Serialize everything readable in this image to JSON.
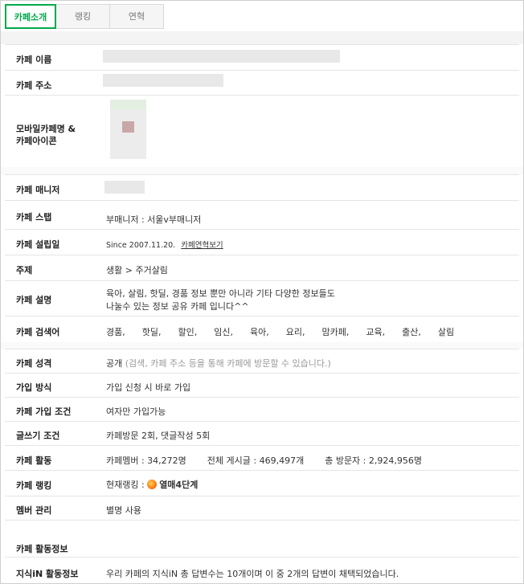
{
  "tabs": [
    {
      "label": "카페소개",
      "active": true
    },
    {
      "label": "랭킹",
      "active": false
    },
    {
      "label": "연혁",
      "active": false
    }
  ],
  "colors": {
    "accent": "#03a94b",
    "border": "#e5e5e5",
    "band": "#f4f4f4"
  },
  "rows": {
    "name": {
      "label": "카페 이름"
    },
    "address": {
      "label": "카페 주소"
    },
    "mobile": {
      "label_line1": "모바일카페명 &",
      "label_line2": "카페아이콘"
    },
    "manager": {
      "label": "카페 매니저"
    },
    "staff": {
      "label": "카페 스탭",
      "value": "부매니저 : 서울v부매니저"
    },
    "founded": {
      "label": "카페 설립일",
      "value": "Since 2007.11.20.",
      "link": "카페연혁보기"
    },
    "topic": {
      "label": "주제",
      "value": "생활 > 주거살림"
    },
    "description": {
      "label": "카페 설명",
      "line1": "육아, 살림, 핫딜, 경품 정보 뿐만 아니라 기타 다양한 정보들도",
      "line2": "나눌수 있는 정보 공유 카페 입니다^^"
    },
    "keywords": {
      "label": "카페 검색어",
      "items": [
        "경품,",
        "핫딜,",
        "할인,",
        "임신,",
        "육아,",
        "요리,",
        "맘카페,",
        "교육,",
        "출산,",
        "살림"
      ]
    },
    "visibility": {
      "label": "카페 성격",
      "value": "공개",
      "note": "(검색, 카페 주소 등을 통해 카페에 방문할 수 있습니다.)"
    },
    "join_method": {
      "label": "가입 방식",
      "value": "가입 신청 시 바로 가입"
    },
    "join_condition": {
      "label": "카페 가입 조건",
      "value": "여자만 가입가능"
    },
    "write_condition": {
      "label": "글쓰기 조건",
      "value": "카페방문 2회, 댓글작성 5회"
    },
    "activity": {
      "label": "카페 활동",
      "members": "카페멤버 : 34,272명",
      "posts": "전체 게시글 : 469,497개",
      "visitors": "총 방문자 : 2,924,956명"
    },
    "ranking": {
      "label": "카페 랭킹",
      "prefix": "현재랭킹 :",
      "rank": "열매4단계",
      "icon": "fruit-icon"
    },
    "member_mgmt": {
      "label": "멤버 관리",
      "value": "별명 사용"
    }
  },
  "activity_section": {
    "title": "카페 활동정보",
    "jisik": {
      "label": "지식iN 활동정보",
      "value": "우리 카페의 지식iN 총 답변수는 10개이며 이 중 2개의 답변이 채택되었습니다."
    }
  }
}
